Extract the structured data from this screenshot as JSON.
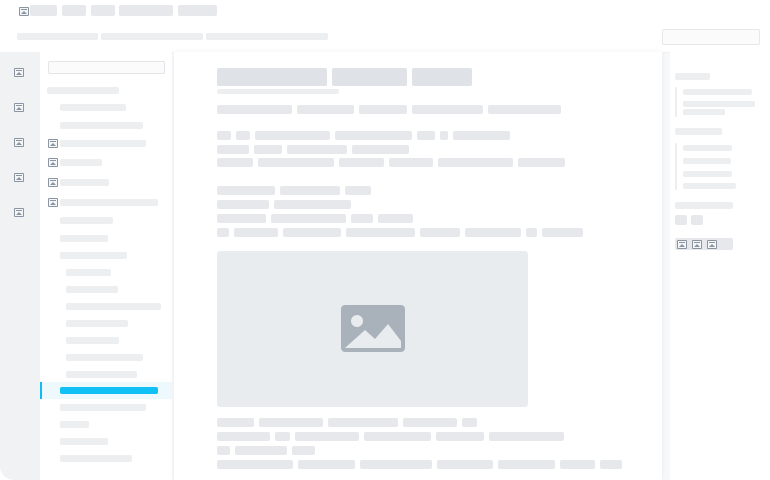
{
  "colors": {
    "accent": "#11c0f4",
    "skeleton": "#e6e8eb",
    "image_glyph": "#a9b1bb",
    "panel": "#ffffff",
    "rail": "#f1f2f4"
  },
  "icons": {
    "top_nav": "window-icon",
    "left_rail": [
      "window-icon",
      "window-icon",
      "window-icon",
      "window-icon",
      "window-icon"
    ],
    "sidebar_tree": [
      "window-icon",
      "window-icon",
      "window-icon",
      "window-icon"
    ],
    "right_panel_actions": [
      "window-icon",
      "window-icon",
      "window-icon"
    ],
    "content_image": "image-icon"
  },
  "sidebar": {
    "active_index": 18
  }
}
